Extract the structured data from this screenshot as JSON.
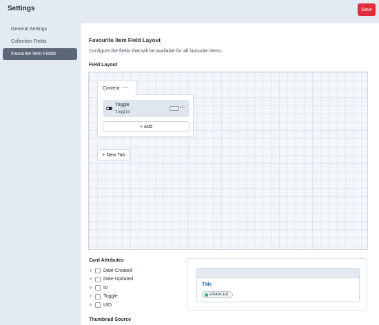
{
  "header": {
    "title": "Settings",
    "save_label": "Save"
  },
  "sidebar": {
    "items": [
      {
        "label": "General Settings",
        "active": false
      },
      {
        "label": "Collection Fields",
        "active": false
      },
      {
        "label": "Favourite Item Fields",
        "active": true
      }
    ]
  },
  "main": {
    "heading": "Favourite Item Field Layout",
    "description": "Configure the fields that will be available for all favourite items.",
    "field_layout_label": "Field Layout",
    "tab": {
      "label": "Content",
      "menu_icon": "ellipsis-icon"
    },
    "field": {
      "name": "Toggle",
      "handle": "toggle",
      "icon": "toggle-icon"
    },
    "add_label": "+ Add",
    "new_tab_label": "+ New Tab",
    "card_attributes_label": "Card Attributes",
    "card_attributes": [
      {
        "label": "Date Created",
        "checked": false
      },
      {
        "label": "Date Updated",
        "checked": false
      },
      {
        "label": "ID",
        "checked": false
      },
      {
        "label": "Toggle",
        "checked": false
      },
      {
        "label": "UID",
        "checked": false
      }
    ],
    "preview": {
      "title": "Title",
      "status": "ENABLED",
      "status_color": "#27ab83"
    },
    "thumbnail_source_label": "Thumbnail Source"
  },
  "colors": {
    "save": "#e12d39",
    "active_nav": "#5b6776",
    "link": "#2563c4"
  }
}
